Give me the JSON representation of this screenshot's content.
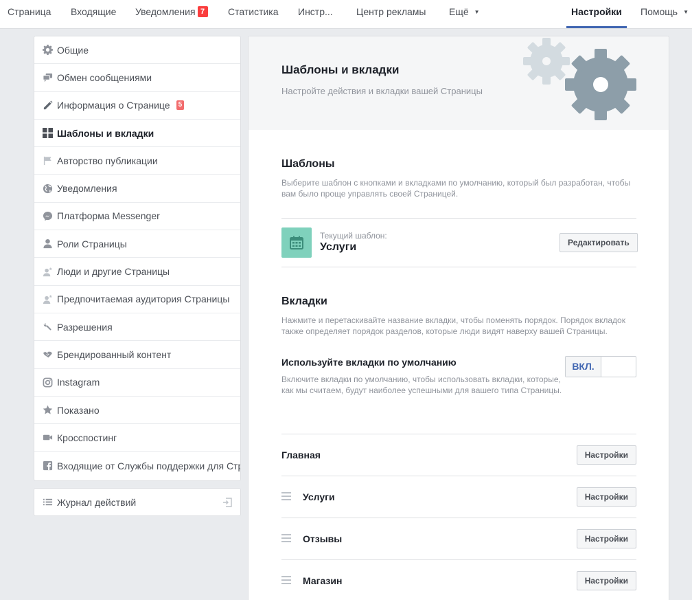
{
  "nav": {
    "items": [
      {
        "label": "Страница"
      },
      {
        "label": "Входящие"
      },
      {
        "label": "Уведомления",
        "badge": "7"
      },
      {
        "label": "Статистика"
      },
      {
        "label": "Инстр..."
      },
      {
        "label": "Центр рекламы"
      },
      {
        "label": "Ещё"
      },
      {
        "label": "Настройки",
        "active": true
      },
      {
        "label": "Помощь"
      }
    ]
  },
  "sidebar": {
    "items": [
      {
        "label": "Общие",
        "icon": "gear-icon"
      },
      {
        "label": "Обмен сообщениями",
        "icon": "chat-icon"
      },
      {
        "label": "Информация о Странице",
        "icon": "pencil-icon",
        "badge": "5"
      },
      {
        "label": "Шаблоны и вкладки",
        "icon": "grid-icon",
        "active": true
      },
      {
        "label": "Авторство публикации",
        "icon": "flag-icon"
      },
      {
        "label": "Уведомления",
        "icon": "globe-icon"
      },
      {
        "label": "Платформа Messenger",
        "icon": "messenger-icon"
      },
      {
        "label": "Роли Страницы",
        "icon": "person-icon"
      },
      {
        "label": "Люди и другие Страницы",
        "icon": "person-star-icon"
      },
      {
        "label": "Предпочитаемая аудитория Страницы",
        "icon": "person-star-icon"
      },
      {
        "label": "Разрешения",
        "icon": "wrench-icon"
      },
      {
        "label": "Брендированный контент",
        "icon": "handshake-icon"
      },
      {
        "label": "Instagram",
        "icon": "instagram-icon"
      },
      {
        "label": "Показано",
        "icon": "star-icon"
      },
      {
        "label": "Кросспостинг",
        "icon": "video-icon"
      },
      {
        "label": "Входящие от Службы поддержки для Стр",
        "icon": "facebook-icon"
      }
    ],
    "activity_log": "Журнал действий"
  },
  "main": {
    "title": "Шаблоны и вкладки",
    "subtitle": "Настройте действия и вкладки вашей Страницы",
    "templates": {
      "title": "Шаблоны",
      "desc": "Выберите шаблон с кнопками и вкладками по умолчанию, который был разработан, чтобы вам было проще управлять своей Страницей.",
      "current_label": "Текущий шаблон:",
      "current_name": "Услуги",
      "edit_button": "Редактировать"
    },
    "tabs": {
      "title": "Вкладки",
      "desc": "Нажмите и перетаскивайте название вкладки, чтобы поменять порядок. Порядок вкладок также определяет порядок разделов, которые люди видят наверху вашей Страницы.",
      "default_title": "Используйте вкладки по умолчанию",
      "default_desc": "Включите вкладки по умолчанию, чтобы использовать вкладки, которые, как мы считаем, будут наиболее успешными для вашего типа Страницы.",
      "toggle_label": "ВКЛ.",
      "settings_button": "Настройки",
      "list": [
        {
          "name": "Главная",
          "draggable": false
        },
        {
          "name": "Услуги",
          "draggable": true
        },
        {
          "name": "Отзывы",
          "draggable": true
        },
        {
          "name": "Магазин",
          "draggable": true
        }
      ]
    }
  },
  "colors": {
    "accent": "#4267b2",
    "badge": "#fa3e3e",
    "template_icon_bg": "#7fd1bc",
    "gear_light": "#d3dbe0",
    "gear_dark": "#8d9ea9"
  }
}
